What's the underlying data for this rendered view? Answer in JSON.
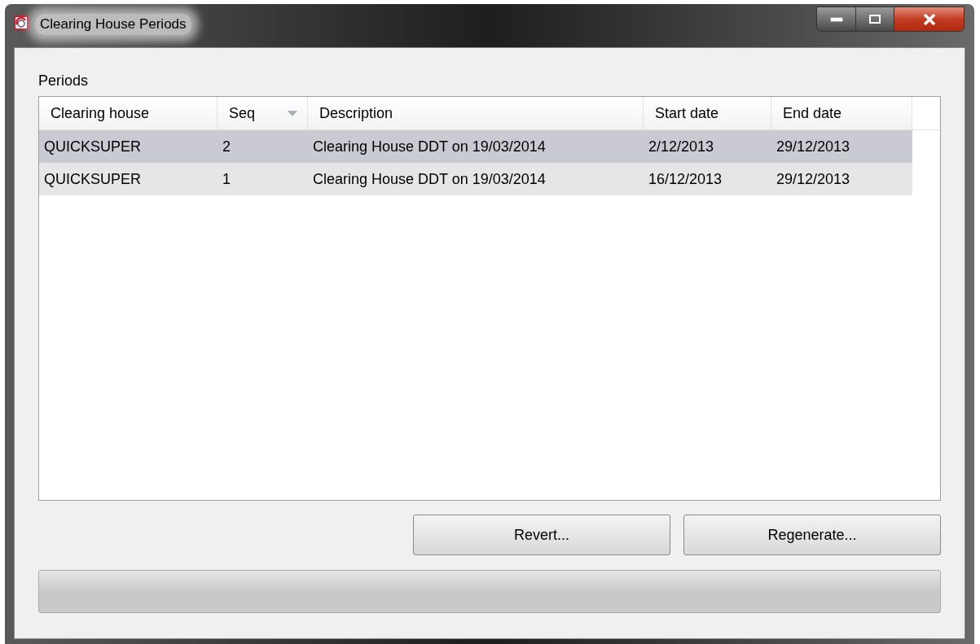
{
  "window": {
    "title": "Clearing House Periods"
  },
  "periods_label": "Periods",
  "table": {
    "columns": [
      {
        "label": "Clearing house",
        "sorted": false
      },
      {
        "label": "Seq",
        "sorted": true
      },
      {
        "label": "Description",
        "sorted": false
      },
      {
        "label": "Start date",
        "sorted": false
      },
      {
        "label": "End date",
        "sorted": false
      }
    ],
    "rows": [
      {
        "cells": [
          "QUICKSUPER",
          "2",
          "Clearing House DDT on 19/03/2014",
          "2/12/2013",
          "29/12/2013"
        ],
        "selected": true
      },
      {
        "cells": [
          "QUICKSUPER",
          "1",
          "Clearing House DDT on 19/03/2014",
          "16/12/2013",
          "29/12/2013"
        ],
        "selected": false
      }
    ]
  },
  "buttons": [
    "Revert...",
    "Regenerate..."
  ],
  "progress": {
    "level": 0
  }
}
